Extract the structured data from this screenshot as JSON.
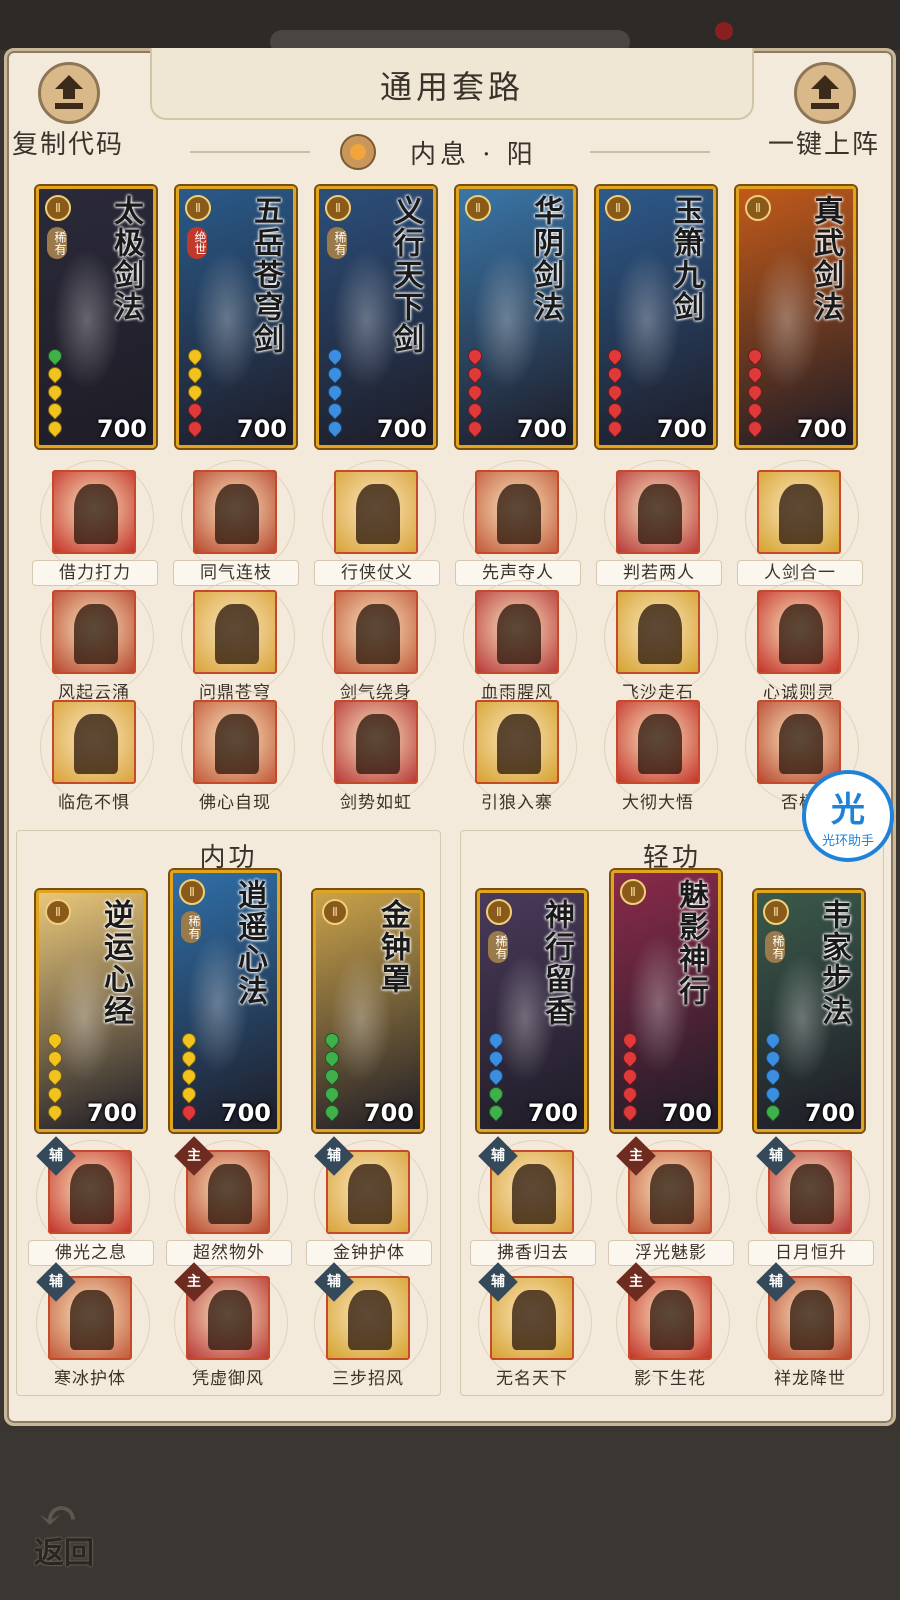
{
  "header": {
    "title": "通用套路",
    "copy_code_label": "复制代码",
    "deploy_label": "一键上阵",
    "subtitle": "内息 · 阳"
  },
  "colors": {
    "gold": "#e0a41f",
    "red": "#c44a2a",
    "panel": "#f3eadb",
    "helper_blue": "#1f82d9"
  },
  "top_cards": [
    {
      "name": "太极剑法",
      "rarity": "稀有",
      "cost": "700",
      "bg": "#2b2a3a",
      "pips": [
        "green",
        "yellow",
        "yellow",
        "yellow",
        "yellow"
      ]
    },
    {
      "name": "五岳苍穹剑",
      "rarity": "绝世",
      "cost": "700",
      "bg": "#2a5a8a",
      "pips": [
        "yellow",
        "yellow",
        "yellow",
        "red",
        "red"
      ]
    },
    {
      "name": "义行天下剑",
      "rarity": "稀有",
      "cost": "700",
      "bg": "#2c4f7c",
      "pips": [
        "blue",
        "blue",
        "blue",
        "blue",
        "blue"
      ]
    },
    {
      "name": "华阴剑法",
      "rarity": "",
      "cost": "700",
      "bg": "#3a76a8",
      "pips": [
        "red",
        "red",
        "red",
        "red",
        "red"
      ]
    },
    {
      "name": "玉箫九剑",
      "rarity": "",
      "cost": "700",
      "bg": "#2d5a8c",
      "pips": [
        "red",
        "red",
        "red",
        "red",
        "red"
      ]
    },
    {
      "name": "真武剑法",
      "rarity": "",
      "cost": "700",
      "bg": "#c25a1a",
      "pips": [
        "red",
        "red",
        "red",
        "red",
        "red"
      ]
    }
  ],
  "skills_rows": [
    [
      "借力打力",
      "同气连枝",
      "行侠仗义",
      "先声夺人",
      "判若两人",
      "人剑合一"
    ],
    [
      "风起云涌",
      "问鼎苍穹",
      "剑气绕身",
      "血雨腥风",
      "飞沙走石",
      "心诚则灵"
    ],
    [
      "临危不惧",
      "佛心自现",
      "剑势如虹",
      "引狼入寨",
      "大彻大悟",
      "否极"
    ]
  ],
  "neigong": {
    "title": "内功",
    "cards": [
      {
        "name": "逆运心经",
        "rarity": "",
        "cost": "700",
        "bg": "#e9c77a",
        "pips": [
          "yellow",
          "yellow",
          "yellow",
          "yellow",
          "yellow"
        ]
      },
      {
        "name": "逍遥心法",
        "rarity": "稀有",
        "cost": "700",
        "bg": "#2f6fa8",
        "pips": [
          "yellow",
          "yellow",
          "yellow",
          "yellow",
          "red"
        ]
      },
      {
        "name": "金钟罩",
        "rarity": "",
        "cost": "700",
        "bg": "#c9a24a",
        "pips": [
          "green",
          "green",
          "green",
          "green",
          "green"
        ]
      }
    ],
    "skills": [
      {
        "label": "佛光之息",
        "tag": "辅"
      },
      {
        "label": "超然物外",
        "tag": "主"
      },
      {
        "label": "金钟护体",
        "tag": "辅"
      },
      {
        "label": "寒冰护体",
        "tag": "辅"
      },
      {
        "label": "凭虚御风",
        "tag": "主"
      },
      {
        "label": "三步招风",
        "tag": "辅"
      }
    ]
  },
  "qinggong": {
    "title": "轻功",
    "cards": [
      {
        "name": "神行留香",
        "rarity": "稀有",
        "cost": "700",
        "bg": "#4a3a5a",
        "pips": [
          "blue",
          "blue",
          "blue",
          "green",
          "green"
        ]
      },
      {
        "name": "魅影神行",
        "rarity": "",
        "cost": "700",
        "bg": "#8a2a4a",
        "pips": [
          "red",
          "red",
          "red",
          "red",
          "red"
        ]
      },
      {
        "name": "韦家步法",
        "rarity": "稀有",
        "cost": "700",
        "bg": "#3a5a4a",
        "pips": [
          "blue",
          "blue",
          "blue",
          "blue",
          "green"
        ]
      }
    ],
    "skills": [
      {
        "label": "拂香归去",
        "tag": "辅"
      },
      {
        "label": "浮光魅影",
        "tag": "主"
      },
      {
        "label": "日月恒升",
        "tag": "辅"
      },
      {
        "label": "无名天下",
        "tag": "辅"
      },
      {
        "label": "影下生花",
        "tag": "主"
      },
      {
        "label": "祥龙降世",
        "tag": "辅"
      }
    ]
  },
  "helper": {
    "glyph": "光",
    "label": "光环助手"
  },
  "back": {
    "label": "返回"
  }
}
